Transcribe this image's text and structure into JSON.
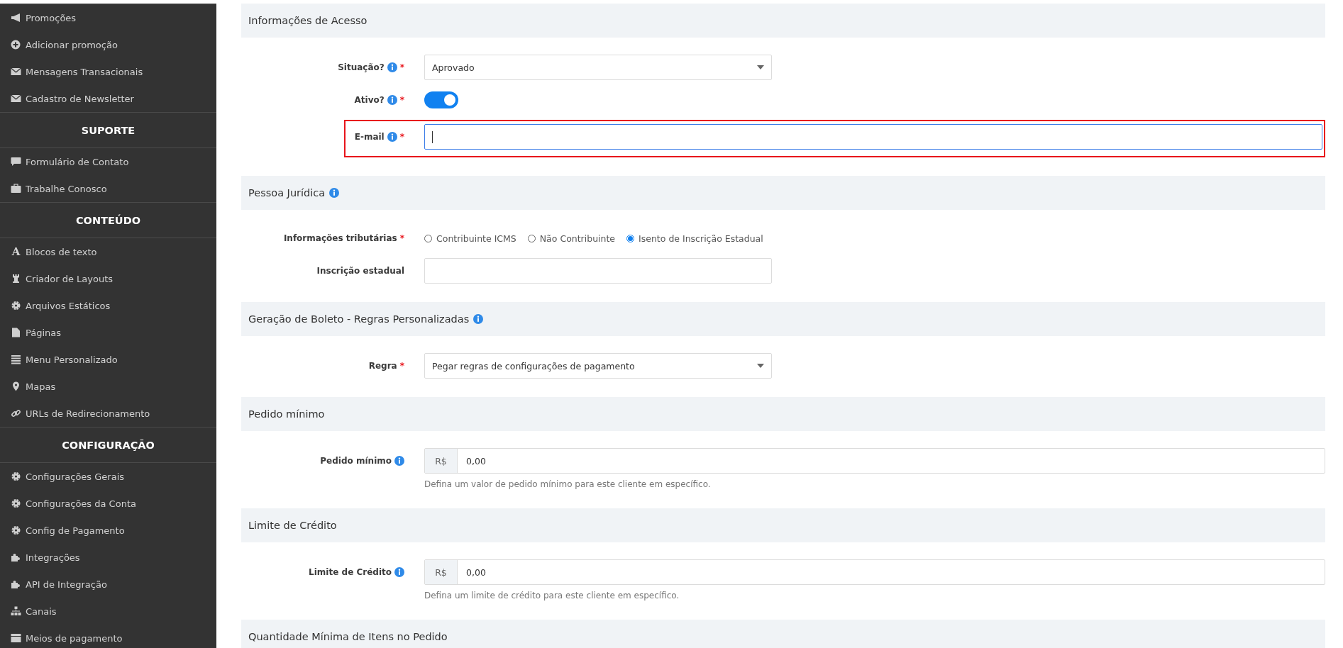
{
  "sidebar": {
    "groups": [
      {
        "items": [
          {
            "kind": "megaphone",
            "label": "Promoções"
          },
          {
            "kind": "plus-circle",
            "label": "Adicionar promoção"
          },
          {
            "kind": "envelope",
            "label": "Mensagens Transacionais"
          },
          {
            "kind": "envelope",
            "label": "Cadastro de Newsletter"
          }
        ]
      },
      {
        "heading": "SUPORTE",
        "items": [
          {
            "kind": "comment",
            "label": "Formulário de Contato"
          },
          {
            "kind": "briefcase",
            "label": "Trabalhe Conosco"
          }
        ]
      },
      {
        "heading": "CONTEÚDO",
        "items": [
          {
            "kind": "glyph",
            "glyph": "A",
            "label": "Blocos de texto"
          },
          {
            "kind": "rook",
            "label": "Criador de Layouts"
          },
          {
            "kind": "gear",
            "label": "Arquivos Estáticos"
          },
          {
            "kind": "file",
            "label": "Páginas"
          },
          {
            "kind": "list",
            "label": "Menu Personalizado"
          },
          {
            "kind": "marker",
            "label": "Mapas"
          },
          {
            "kind": "link",
            "label": "URLs de Redirecionamento"
          }
        ]
      },
      {
        "heading": "CONFIGURAÇÃO",
        "items": [
          {
            "kind": "gear",
            "label": "Configurações Gerais"
          },
          {
            "kind": "gear",
            "label": "Configurações da Conta"
          },
          {
            "kind": "gear",
            "label": "Config de Pagamento"
          },
          {
            "kind": "puzzle",
            "label": "Integrações"
          },
          {
            "kind": "puzzle",
            "label": "API de Integração"
          },
          {
            "kind": "sitemap",
            "label": "Canais"
          },
          {
            "kind": "card",
            "label": "Meios de pagamento"
          }
        ]
      }
    ]
  },
  "sections": [
    {
      "title": "Informações de Acesso",
      "info": false,
      "fields": [
        {
          "kind": "select",
          "label": "Situação?",
          "info": true,
          "required_mark": "*",
          "value": "Aprovado",
          "wide": false
        },
        {
          "kind": "toggle",
          "label": "Ativo?",
          "info": true,
          "required_mark": "*",
          "on": true
        },
        {
          "kind": "input",
          "label": "E-mail",
          "info": true,
          "required_mark": "*",
          "wide": true,
          "focused": true,
          "highlighted": true
        }
      ]
    },
    {
      "title": "Pessoa Jurídica",
      "info": true,
      "fields": [
        {
          "kind": "radio",
          "label": "Informações tributárias",
          "info": false,
          "required_mark": "*",
          "options": [
            {
              "label": "Contribuinte ICMS",
              "selected": false
            },
            {
              "label": "Não Contribuinte",
              "selected": false
            },
            {
              "label": "Isento de Inscrição Estadual",
              "selected": true
            }
          ]
        },
        {
          "kind": "input",
          "label": "Inscrição estadual",
          "info": false,
          "wide": false,
          "focused": false,
          "highlighted": false
        }
      ]
    },
    {
      "title": "Geração de Boleto - Regras Personalizadas",
      "info": true,
      "fields": [
        {
          "kind": "select",
          "label": "Regra",
          "info": false,
          "required_mark": "*",
          "value": "Pegar regras de configurações de pagamento",
          "wide": false
        }
      ]
    },
    {
      "title": "Pedido mínimo",
      "info": false,
      "fields": [
        {
          "kind": "currency",
          "label": "Pedido mínimo",
          "info": true,
          "prefix": "R$",
          "value": "0,00",
          "help": "Defina um valor de pedido mínimo para este cliente em específico."
        }
      ]
    },
    {
      "title": "Limite de Crédito",
      "info": false,
      "fields": [
        {
          "kind": "currency",
          "label": "Limite de Crédito",
          "info": true,
          "prefix": "R$",
          "value": "0,00",
          "help": "Defina um limite de crédito para este cliente em específico."
        }
      ]
    },
    {
      "title": "Quantidade Mínima de Itens no Pedido",
      "info": false
    }
  ]
}
